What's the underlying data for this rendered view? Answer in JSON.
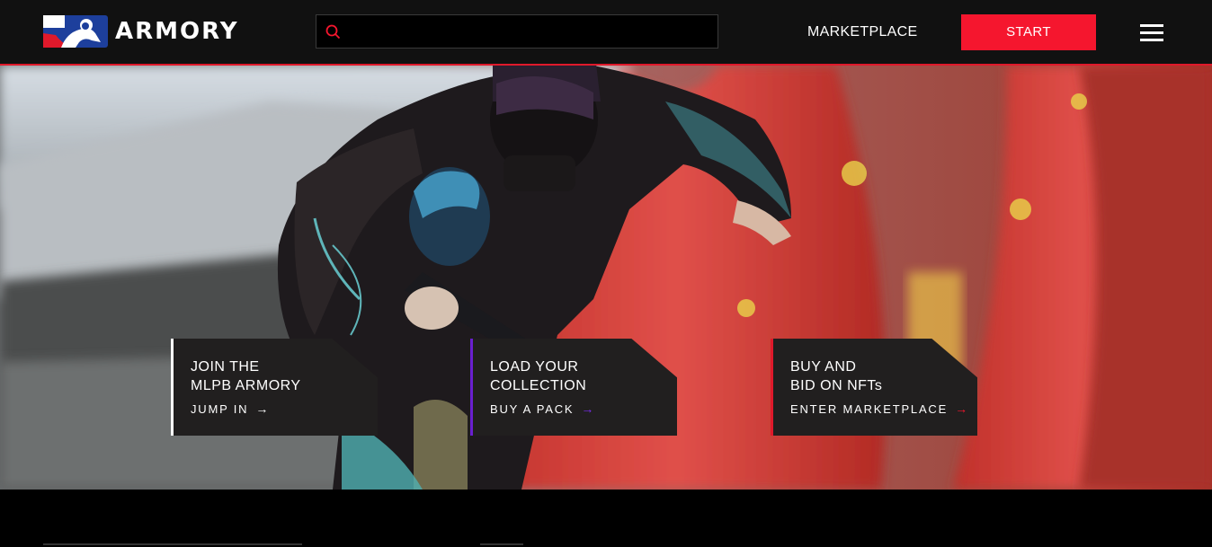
{
  "header": {
    "brand": "ARMORY",
    "search": {
      "placeholder": "",
      "value": ""
    },
    "nav_link": "MARKETPLACE",
    "start_label": "START",
    "accent_color": "#f5162e"
  },
  "icons": {
    "search": "search-icon",
    "menu": "hamburger-menu-icon",
    "arrow": "arrow-right-icon"
  },
  "cards": [
    {
      "title": "JOIN THE\nMLPB ARMORY",
      "link": "JUMP IN",
      "accent": "#ffffff",
      "arrow_color": "#ffffff"
    },
    {
      "title": "LOAD YOUR\nCOLLECTION",
      "link": "BUY A PACK",
      "accent": "#6a1fd0",
      "arrow_color": "#7a2cf0"
    },
    {
      "title": "BUY AND\nBID ON NFTs",
      "link": "ENTER MARKETPLACE",
      "accent": "#e0192b",
      "arrow_color": "#f5162e"
    }
  ]
}
